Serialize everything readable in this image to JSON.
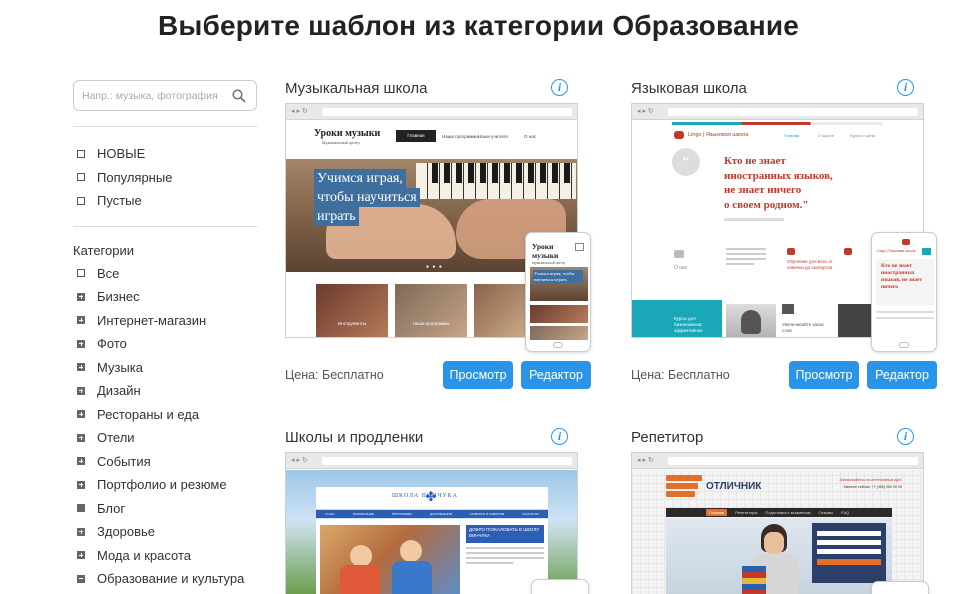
{
  "page": {
    "title": "Выберите шаблон из категории Образование"
  },
  "search": {
    "placeholder": "Напр.: музыка, фотография"
  },
  "filters": [
    {
      "label": "НОВЫЕ",
      "checkbox": "empty"
    },
    {
      "label": "Популярные",
      "checkbox": "empty"
    },
    {
      "label": "Пустые",
      "checkbox": "empty"
    }
  ],
  "categories_label": "Категории",
  "categories": [
    {
      "label": "Все",
      "checkbox": "empty"
    },
    {
      "label": "Бизнес",
      "checkbox": "plus"
    },
    {
      "label": "Интернет-магазин",
      "checkbox": "plus"
    },
    {
      "label": "Фото",
      "checkbox": "plus"
    },
    {
      "label": "Музыка",
      "checkbox": "plus"
    },
    {
      "label": "Дизайн",
      "checkbox": "plus"
    },
    {
      "label": "Рестораны и еда",
      "checkbox": "plus"
    },
    {
      "label": "Отели",
      "checkbox": "plus"
    },
    {
      "label": "События",
      "checkbox": "plus"
    },
    {
      "label": "Портфолио и резюме",
      "checkbox": "plus"
    },
    {
      "label": "Блог",
      "checkbox": "solid"
    },
    {
      "label": "Здоровье",
      "checkbox": "plus"
    },
    {
      "label": "Мода и красота",
      "checkbox": "plus"
    },
    {
      "label": "Образование и культура",
      "checkbox": "minus"
    }
  ],
  "cards": [
    {
      "title": "Музыкальная школа",
      "price": "Цена: Бесплатно",
      "view_label": "Просмотр",
      "edit_label": "Редактор",
      "thumb": {
        "site_title": "Уроки музыки",
        "site_subtitle": "Музыкальный центр",
        "nav_active": "Главная",
        "nav_2": "Наши программы",
        "nav_3": "Наши учителя",
        "nav_4": "О нас",
        "headline_1": "Учимся играя,",
        "headline_2": "чтобы научиться",
        "headline_3": "играть",
        "tile_1": "Инструменты",
        "tile_2": "Наши программы",
        "mobile_title_1": "Уроки",
        "mobile_title_2": "музыки",
        "mobile_sub": "Музыкальный центр",
        "mobile_headline": "Учимся играя, чтобы научиться играть"
      }
    },
    {
      "title": "Языковая школа",
      "price": "Цена: Бесплатно",
      "view_label": "Просмотр",
      "edit_label": "Редактор",
      "thumb": {
        "logo": "Lingo | Языковая школа",
        "nav_1": "Главная",
        "nav_2": "О школе",
        "nav_3": "Курсы и цены",
        "quote_1": "Кто не знает",
        "quote_2": "иностранных языков,",
        "quote_3": "не знает ничего",
        "quote_4": "о своем родном.\"",
        "block_1": "Обучение для всех от новичка до экспертов",
        "block_2": "Курсы для бизнесменов: эффективное",
        "block_3": "Увеличивайте запас слов",
        "about": "О нас",
        "mobile_logo": "Lingo | Языковая школа",
        "mobile_quote": "Кто не знает иностранных языков, не знает ничего"
      }
    },
    {
      "title": "Школы и продленки",
      "thumb": {
        "logo": "ШКОЛА ВИНЧУКА",
        "nav": [
          "О НАС",
          "РАСПИСАНИЕ",
          "ПРОГРАММЫ",
          "ДОСТИЖЕНИЯ",
          "НОВОСТИ И СОБЫТИЯ",
          "КОНТАКТЫ"
        ],
        "welcome": "ДОБРО ПОЖАЛОВАТЬ В ШКОЛУ ВИНЧУКА"
      }
    },
    {
      "title": "Репетитор",
      "thumb": {
        "logo": "ОТЛИЧНИК",
        "tagline": "Записывайтесь на интенсивный курс!",
        "phone": "Звоните сейчас: +7 (495) 000 00 00",
        "nav": [
          "Главная",
          "Репетиторы",
          "Подготовка к экзаменам",
          "Отзывы",
          "FAQ"
        ]
      }
    }
  ],
  "colors": {
    "accent": "#2a95e8",
    "music_headline_bg": "#3f6f9e",
    "lingo_red": "#c0392b",
    "lingo_teal": "#1aa8b8",
    "school_blue": "#2c5fb4",
    "tutor_orange": "#e46f28"
  }
}
